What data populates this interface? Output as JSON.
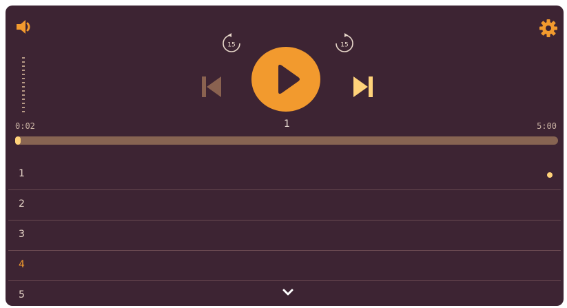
{
  "player": {
    "time_current": "0:02",
    "time_duration": "5:00",
    "track_number": "1",
    "progress_fraction": 0.007,
    "skip_back_seconds": "15",
    "skip_forward_seconds": "15",
    "accent": "#f29a2e",
    "background": "#3d2433"
  },
  "icons": {
    "volume": "speaker-icon",
    "settings": "gear-icon",
    "skip_back": "rewind-15-icon",
    "skip_forward": "forward-15-icon",
    "play": "play-icon",
    "previous": "skip-previous-icon",
    "next": "skip-next-icon",
    "expand": "chevron-down-icon"
  },
  "tracklist": {
    "items": [
      {
        "label": "1",
        "playing": true
      },
      {
        "label": "2",
        "playing": false
      },
      {
        "label": "3",
        "playing": false
      },
      {
        "label": "4",
        "highlighted": true
      },
      {
        "label": "5",
        "playing": false
      }
    ]
  }
}
